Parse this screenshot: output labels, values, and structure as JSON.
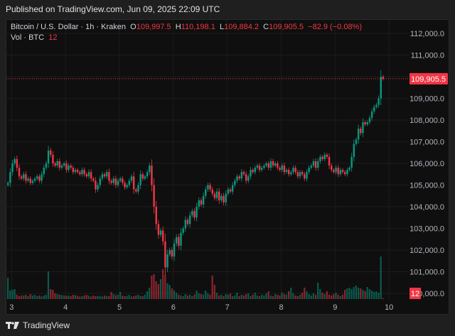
{
  "published": "Published on TradingView.com, Jun 09, 2025 22:09 UTC",
  "legend": {
    "symbol": "Bitcoin / U.S. Dollar · 1h · Kraken",
    "o_label": "O",
    "o": "109,997.5",
    "h_label": "H",
    "h": "110,198.1",
    "l_label": "L",
    "l": "109,884.2",
    "c_label": "C",
    "c": "109,905.5",
    "change": "−82.9 (−0.08%)",
    "vol_label": "Vol · BTC",
    "vol": "12"
  },
  "price_axis": {
    "ticks": [
      "112,000.0",
      "111,000.0",
      "110,000.0",
      "109,000.0",
      "108,000.0",
      "107,000.0",
      "106,000.0",
      "105,000.0",
      "104,000.0",
      "103,000.0",
      "102,000.0",
      "101,000.0",
      "100,000.0"
    ],
    "tick_values": [
      112000,
      111000,
      110000,
      109000,
      108000,
      107000,
      106000,
      105000,
      104000,
      103000,
      102000,
      101000,
      100000
    ],
    "last_price_label": "109,905.5",
    "last_price": 109905.5,
    "volume_label": "12"
  },
  "time_axis": {
    "ticks": [
      "3",
      "4",
      "5",
      "6",
      "7",
      "8",
      "9",
      "10"
    ]
  },
  "colors": {
    "up": "#089981",
    "down": "#f23645",
    "background": "#0f0f0f",
    "grid": "#1c1c1c"
  },
  "chart_data": {
    "type": "candlestick",
    "interval": "1h",
    "start_open": 105000,
    "closes": [
      105100,
      105600,
      106000,
      106200,
      105800,
      105400,
      105300,
      105500,
      105200,
      105300,
      105100,
      105200,
      105300,
      105400,
      105200,
      105500,
      105800,
      106000,
      106600,
      106400,
      106000,
      105900,
      106100,
      105800,
      105900,
      106000,
      105700,
      105900,
      105800,
      105600,
      105700,
      105600,
      105500,
      105700,
      105500,
      105400,
      105600,
      105300,
      105200,
      104800,
      105000,
      105300,
      105500,
      105400,
      105600,
      105200,
      105100,
      105300,
      105000,
      105200,
      105300,
      105100,
      104900,
      105000,
      105200,
      105400,
      104800,
      104700,
      105000,
      105500,
      105300,
      105400,
      105600,
      105900,
      105000,
      104000,
      103200,
      102700,
      102900,
      102400,
      101200,
      101800,
      102000,
      101700,
      102300,
      102600,
      102200,
      102800,
      103000,
      103400,
      103200,
      103600,
      103800,
      103500,
      104000,
      104300,
      104100,
      104500,
      104800,
      105000,
      104800,
      104600,
      104400,
      104700,
      104300,
      104500,
      104200,
      104600,
      104800,
      104700,
      105000,
      105200,
      105400,
      105300,
      105600,
      105500,
      105200,
      105400,
      105700,
      105600,
      105800,
      105900,
      105700,
      105800,
      105900,
      106000,
      105800,
      106100,
      105900,
      106000,
      105800,
      105700,
      105900,
      105600,
      105700,
      105500,
      105600,
      105800,
      105600,
      105400,
      105600,
      105500,
      105300,
      105600,
      105800,
      105900,
      106100,
      105800,
      106100,
      106300,
      106200,
      106400,
      106300,
      105900,
      105700,
      105600,
      105800,
      105500,
      105700,
      105600,
      105500,
      105700,
      105800,
      106300,
      106900,
      107100,
      107600,
      107400,
      107900,
      107800,
      107900,
      108100,
      108400,
      108600,
      108700,
      109000,
      109997.5,
      109905.5
    ],
    "volumes": [
      300,
      120,
      130,
      140,
      60,
      40,
      50,
      50,
      60,
      40,
      70,
      50,
      60,
      40,
      50,
      35,
      50,
      60,
      390,
      140,
      130,
      80,
      70,
      60,
      55,
      50,
      45,
      50,
      40,
      60,
      55,
      45,
      35,
      40,
      50,
      60,
      45,
      35,
      50,
      40,
      45,
      40,
      35,
      50,
      45,
      40,
      100,
      70,
      55,
      60,
      100,
      50,
      40,
      45,
      60,
      35,
      40,
      50,
      60,
      45,
      40,
      60,
      110,
      160,
      330,
      350,
      250,
      210,
      280,
      420,
      340,
      220,
      200,
      150,
      120,
      90,
      60,
      50,
      40,
      70,
      50,
      60,
      40,
      60,
      120,
      80,
      70,
      60,
      120,
      80,
      60,
      330,
      200,
      90,
      50,
      60,
      40,
      70,
      60,
      80,
      40,
      50,
      90,
      40,
      60,
      50,
      70,
      80,
      40,
      60,
      90,
      50,
      40,
      60,
      50,
      80,
      110,
      50,
      40,
      70,
      60,
      50,
      90,
      70,
      60,
      110,
      160,
      80,
      50,
      40,
      60,
      90,
      160,
      110,
      70,
      50,
      80,
      60,
      230,
      140,
      90,
      70,
      110,
      60,
      50,
      70,
      90,
      60,
      40,
      60,
      130,
      150,
      160,
      140,
      170,
      190,
      160,
      150,
      130,
      110,
      170,
      140,
      120,
      100,
      110,
      90,
      600,
      12
    ],
    "ylim": [
      100000,
      112000
    ]
  }
}
